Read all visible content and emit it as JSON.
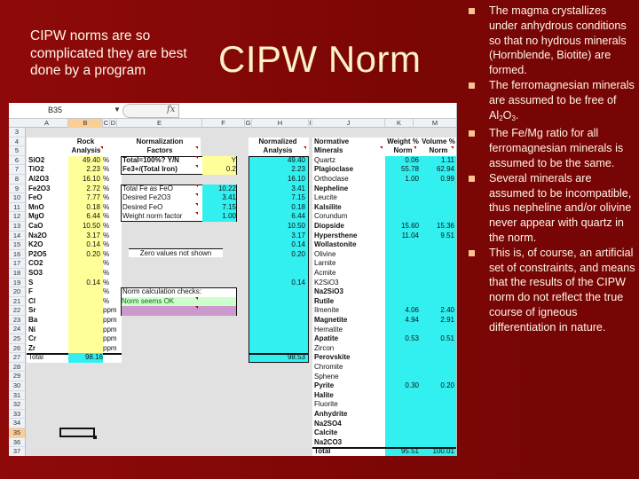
{
  "slide": {
    "subtitle": "CIPW norms are so complicated they are best done by a program",
    "title": "CIPW Norm",
    "bullets": [
      {
        "text": "The magma crystallizes under anhydrous conditions so that no hydrous minerals (Hornblende, Biotite) are formed."
      },
      {
        "text_before": "The ferromagnesian minerals are assumed to be free of Al",
        "sub1": "2",
        "mid": "O",
        "sub2": "3",
        "text_after": "."
      },
      {
        "text": "The Fe/Mg ratio for all ferromagnesian minerals is assumed to be the same."
      },
      {
        "text": "Several minerals are assumed to be incompatible, thus nepheline and/or olivine never appear with quartz in the norm."
      },
      {
        "text": "This is, of course, an artificial set of constraints, and means that the results of the CIPW norm do not reflect the true course of igneous differentiation in nature."
      }
    ]
  },
  "excel": {
    "name_box": "B35",
    "fx_label": "fx",
    "columns": [
      "A",
      "B",
      "C",
      "D",
      "E",
      "F",
      "G",
      "H",
      "I",
      "J",
      "K",
      "M"
    ],
    "rows": [
      "3",
      "4",
      "5",
      "6",
      "7",
      "8",
      "9",
      "10",
      "11",
      "12",
      "13",
      "14",
      "15",
      "16",
      "17",
      "18",
      "19",
      "20",
      "21",
      "22",
      "23",
      "24",
      "25",
      "26",
      "27",
      "28",
      "29",
      "30",
      "31",
      "32",
      "33",
      "34",
      "35",
      "36",
      "37"
    ],
    "selected_row": "35",
    "rock": {
      "header1": "Rock",
      "header2": "Analysis",
      "items": [
        {
          "oxide": "SiO2",
          "value": "49.40",
          "unit": "%"
        },
        {
          "oxide": "TiO2",
          "value": "2.23",
          "unit": "%"
        },
        {
          "oxide": "Al2O3",
          "value": "16.10",
          "unit": "%"
        },
        {
          "oxide": "Fe2O3",
          "value": "2.72",
          "unit": "%"
        },
        {
          "oxide": "FeO",
          "value": "7.77",
          "unit": "%"
        },
        {
          "oxide": "MnO",
          "value": "0.18",
          "unit": "%"
        },
        {
          "oxide": "MgO",
          "value": "6.44",
          "unit": "%"
        },
        {
          "oxide": "CaO",
          "value": "10.50",
          "unit": "%"
        },
        {
          "oxide": "Na2O",
          "value": "3.17",
          "unit": "%"
        },
        {
          "oxide": "K2O",
          "value": "0.14",
          "unit": "%"
        },
        {
          "oxide": "P2O5",
          "value": "0.20",
          "unit": "%"
        },
        {
          "oxide": "CO2",
          "value": "",
          "unit": "%"
        },
        {
          "oxide": "SO3",
          "value": "",
          "unit": "%"
        },
        {
          "oxide": "S",
          "value": "0.14",
          "unit": "%"
        },
        {
          "oxide": "F",
          "value": "",
          "unit": "%"
        },
        {
          "oxide": "Cl",
          "value": "",
          "unit": "%"
        },
        {
          "oxide": "Sr",
          "value": "",
          "unit": "ppm"
        },
        {
          "oxide": "Ba",
          "value": "",
          "unit": "ppm"
        },
        {
          "oxide": "Ni",
          "value": "",
          "unit": "ppm"
        },
        {
          "oxide": "Cr",
          "value": "",
          "unit": "ppm"
        },
        {
          "oxide": "Zr",
          "value": "",
          "unit": "ppm"
        }
      ],
      "total_label": "Total",
      "total_value": "98.16"
    },
    "normalization": {
      "header1": "Normalization",
      "header2": "Factors",
      "inputs": [
        {
          "label": "Total=100%? Y/N",
          "value": "Y"
        },
        {
          "label": "Fe3+/(Total Iron)",
          "value": "0.2"
        }
      ],
      "computed": [
        {
          "label": "Total Fe as FeO",
          "value": "10.22"
        },
        {
          "label": "Desired Fe2O3",
          "value": "3.41"
        },
        {
          "label": "Desired FeO",
          "value": "7.15"
        },
        {
          "label": "Weight norm factor",
          "value": "1.00"
        }
      ],
      "zero_note": "Zero values not shown",
      "checks_title": "Norm calculation checks:",
      "checks_status": "Norm seems OK",
      "checks_extra": ""
    },
    "normalized": {
      "header1": "Normalized",
      "header2": "Analysis",
      "values": [
        "49.40",
        "2.23",
        "16.10",
        "3.41",
        "7.15",
        "0.18",
        "6.44",
        "10.50",
        "3.17",
        "0.14",
        "0.20",
        "",
        "",
        "0.14",
        "",
        "",
        "",
        "",
        "",
        "",
        ""
      ],
      "total": "98.53"
    },
    "minerals": {
      "header_name1": "Normative",
      "header_name2": "Minerals",
      "header_wt1": "Weight %",
      "header_wt2": "Norm",
      "header_vol1": "Volume %",
      "header_vol2": "Norm",
      "items": [
        {
          "name": "Quartz",
          "bold": false,
          "wt": "0.06",
          "vol": "1.11"
        },
        {
          "name": "Plagioclase",
          "bold": true,
          "wt": "55.78",
          "vol": "62.94"
        },
        {
          "name": "Orthoclase",
          "bold": false,
          "wt": "1.00",
          "vol": "0.99"
        },
        {
          "name": "Nepheline",
          "bold": true,
          "wt": "",
          "vol": ""
        },
        {
          "name": "Leucite",
          "bold": false,
          "wt": "",
          "vol": ""
        },
        {
          "name": "Kalsilite",
          "bold": true,
          "wt": "",
          "vol": ""
        },
        {
          "name": "Corundum",
          "bold": false,
          "wt": "",
          "vol": ""
        },
        {
          "name": "Diopside",
          "bold": true,
          "wt": "15.60",
          "vol": "15.36"
        },
        {
          "name": "Hypersthene",
          "bold": true,
          "wt": "11.04",
          "vol": "9.51"
        },
        {
          "name": "Wollastonite",
          "bold": true,
          "wt": "",
          "vol": ""
        },
        {
          "name": "Olivine",
          "bold": false,
          "wt": "",
          "vol": ""
        },
        {
          "name": "Larnite",
          "bold": false,
          "wt": "",
          "vol": ""
        },
        {
          "name": "Acmite",
          "bold": false,
          "wt": "",
          "vol": ""
        },
        {
          "name": "K2SiO3",
          "bold": false,
          "wt": "",
          "vol": ""
        },
        {
          "name": "Na2SiO3",
          "bold": true,
          "wt": "",
          "vol": ""
        },
        {
          "name": "Rutile",
          "bold": true,
          "wt": "",
          "vol": ""
        },
        {
          "name": "Ilmenite",
          "bold": false,
          "wt": "4.06",
          "vol": "2.40"
        },
        {
          "name": "Magnetite",
          "bold": true,
          "wt": "4.94",
          "vol": "2.91"
        },
        {
          "name": "Hematite",
          "bold": false,
          "wt": "",
          "vol": ""
        },
        {
          "name": "Apatite",
          "bold": true,
          "wt": "0.53",
          "vol": "0.51"
        },
        {
          "name": "Zircon",
          "bold": false,
          "wt": "",
          "vol": ""
        },
        {
          "name": "Perovskite",
          "bold": true,
          "wt": "",
          "vol": ""
        },
        {
          "name": "Chromite",
          "bold": false,
          "wt": "",
          "vol": ""
        },
        {
          "name": "Sphene",
          "bold": false,
          "wt": "",
          "vol": ""
        },
        {
          "name": "Pyrite",
          "bold": true,
          "wt": "0.30",
          "vol": "0.20"
        },
        {
          "name": "Halite",
          "bold": true,
          "wt": "",
          "vol": ""
        },
        {
          "name": "Fluorite",
          "bold": false,
          "wt": "",
          "vol": ""
        },
        {
          "name": "Anhydrite",
          "bold": true,
          "wt": "",
          "vol": ""
        },
        {
          "name": "Na2SO4",
          "bold": true,
          "wt": "",
          "vol": ""
        },
        {
          "name": "Calcite",
          "bold": true,
          "wt": "",
          "vol": ""
        },
        {
          "name": "Na2CO3",
          "bold": true,
          "wt": "",
          "vol": ""
        }
      ],
      "total_label": "Total",
      "total_wt": "95.51",
      "total_vol": "100.01"
    }
  }
}
